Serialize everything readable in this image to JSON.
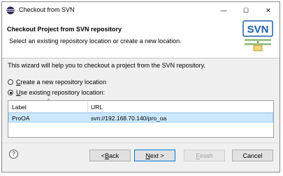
{
  "window": {
    "title": "Checkout from SVN",
    "controls": {
      "minimize": "—",
      "maximize": "☐",
      "close": "✕"
    }
  },
  "header": {
    "title": "Checkout Project from SVN repository",
    "description": "Select an existing repository location or create a new location.",
    "logo_text": "SVN"
  },
  "body": {
    "intro": "This wizard will help you to checkout a project from the SVN repository.",
    "options": [
      {
        "mnemonic": "C",
        "rest": "reate a new repository location",
        "selected": false
      },
      {
        "mnemonic": "U",
        "rest": "se existing repository location:",
        "selected": true
      }
    ]
  },
  "table": {
    "columns": [
      "Label",
      "URL"
    ],
    "rows": [
      {
        "label": "ProOA",
        "url": "svn://192.168.70.140/pro_oa",
        "selected": true
      }
    ]
  },
  "footer": {
    "help": "?",
    "back": {
      "prefix": "< ",
      "mnemonic": "B",
      "rest": "ack"
    },
    "next": {
      "mnemonic": "N",
      "rest": "ext >"
    },
    "finish": {
      "mnemonic": "F",
      "rest": "inish",
      "enabled": false
    },
    "cancel": "Cancel"
  },
  "colors": {
    "selection": "#cce8ff",
    "accent": "#0078d7",
    "logo_blue": "#1f5fa8"
  }
}
